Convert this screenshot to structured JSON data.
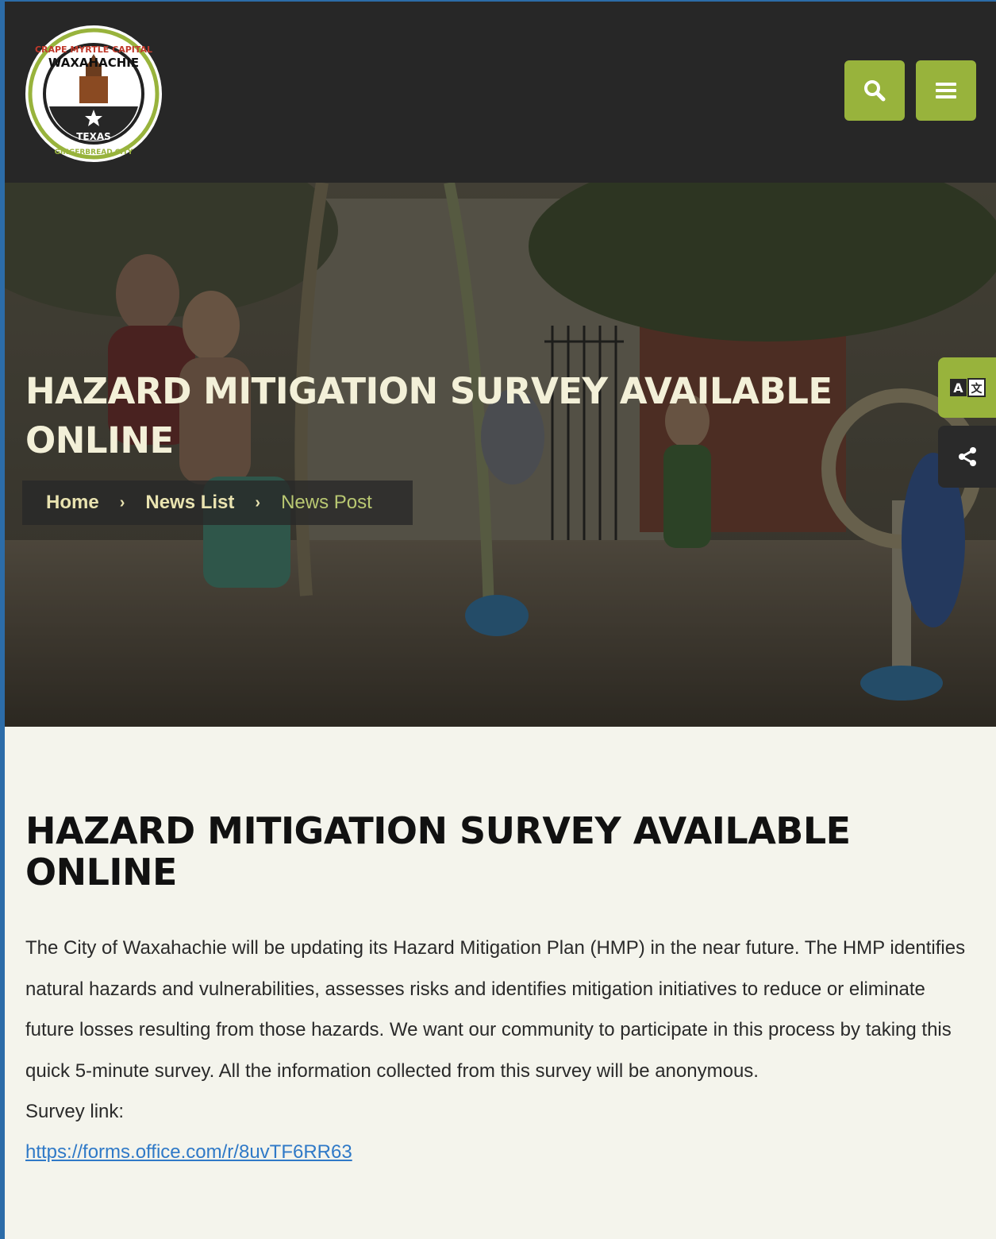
{
  "header": {
    "logo": {
      "top_text": "CRAPE MYRTLE CAPITAL",
      "city": "WAXAHACHIE",
      "state": "TEXAS",
      "bottom_text": "GINGERBREAD CITY"
    },
    "search_icon": "search-icon",
    "menu_icon": "hamburger-menu-icon"
  },
  "hero": {
    "title": "HAZARD MITIGATION SURVEY AVAILABLE ONLINE",
    "breadcrumb": {
      "home": "Home",
      "separator": "›",
      "news_list": "News List",
      "current": "News Post"
    }
  },
  "side_tools": {
    "translate_icon": "translate-icon",
    "share_icon": "share-icon"
  },
  "post": {
    "title": "HAZARD MITIGATION SURVEY AVAILABLE ONLINE",
    "body": "The City of Waxahachie will be updating its Hazard Mitigation Plan (HMP) in the near future. The HMP identifies natural hazards and vulnerabilities, assesses risks and identifies mitigation initiatives to reduce or eliminate future losses resulting from those hazards. We want our community to participate in this process by taking this quick 5-minute survey. All the information collected from this survey will be anonymous.",
    "link_label": "Survey link:",
    "link_url": "https://forms.office.com/r/8uvTF6RR63"
  },
  "colors": {
    "accent": "#98b33c",
    "header_bg": "#272727",
    "page_bg": "#f4f4ec",
    "link": "#2f79c7"
  }
}
